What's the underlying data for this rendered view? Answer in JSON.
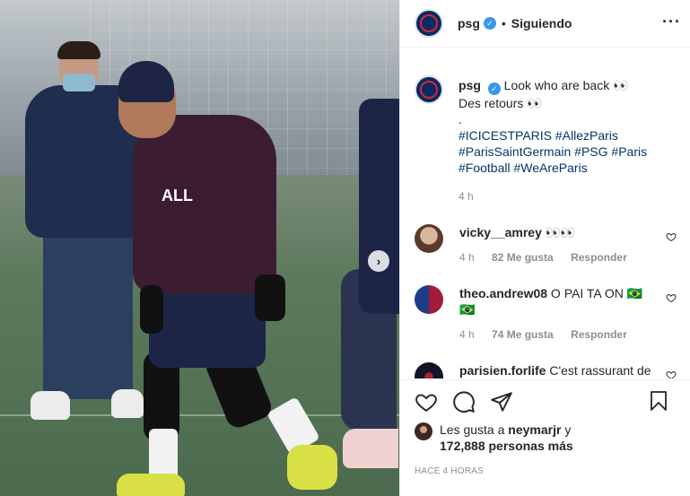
{
  "post_header": {
    "username": "psg",
    "separator": "•",
    "follow_status": "Siguiendo",
    "more_icon": "more-options-icon"
  },
  "caption": {
    "username": "psg",
    "line1": "Look who are back 👀",
    "line2": "Des retours 👀",
    "line3": ".",
    "hashtags": [
      "#ICICESTPARIS",
      "#AllezParis",
      "#ParisSaintGermain",
      "#PSG",
      "#Paris",
      "#Football",
      "#WeAreParis"
    ],
    "time": "4 h"
  },
  "comments": [
    {
      "username": "vicky__amrey",
      "text": "👀👀",
      "time": "4 h",
      "likes": "82 Me gusta",
      "reply": "Responder"
    },
    {
      "username": "theo.andrew08",
      "text": "O PAI TA ON 🇧🇷🇧🇷",
      "time": "4 h",
      "likes": "74 Me gusta",
      "reply": "Responder"
    },
    {
      "username": "parisien.forlife",
      "text": "C'est rassurant de le voir Ney",
      "time": "",
      "likes": "",
      "reply": ""
    }
  ],
  "likes_summary": {
    "prefix": "Les gusta a",
    "liker": "neymarjr",
    "connector": "y",
    "count": "172,888 personas más"
  },
  "posted_ago": "HACE 4 HORAS",
  "colors": {
    "link": "#00376b",
    "verified": "#3897f0",
    "muted": "#8e8e8e"
  }
}
